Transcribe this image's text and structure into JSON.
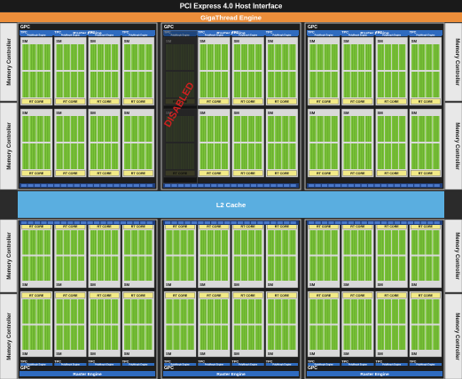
{
  "header": {
    "pcie": "PCI Express 4.0 Host Interface",
    "gigathread": "GigaThread Engine"
  },
  "gpc_label": "GPC",
  "raster_engine": "Raster Engine",
  "tpc_label": "TPC",
  "polymorph_engine": "PolyMorph Engine",
  "sm_label": "SM",
  "rt_core": "RT CORE",
  "memory_controller": "Memory Controller",
  "l2_cache": "L2 Cache",
  "disabled_label": "DISABLED",
  "colors": {
    "background": "#2b2b2b",
    "header_bg": "#1a1a1a",
    "gigathread": "#ec8e3a",
    "raster": "#2f6bbf",
    "l2": "#5aaee0",
    "cuda_green": "#7cc53a",
    "rt_yellow": "#f2ea86",
    "gpc_frame": "#b9b9b9"
  }
}
